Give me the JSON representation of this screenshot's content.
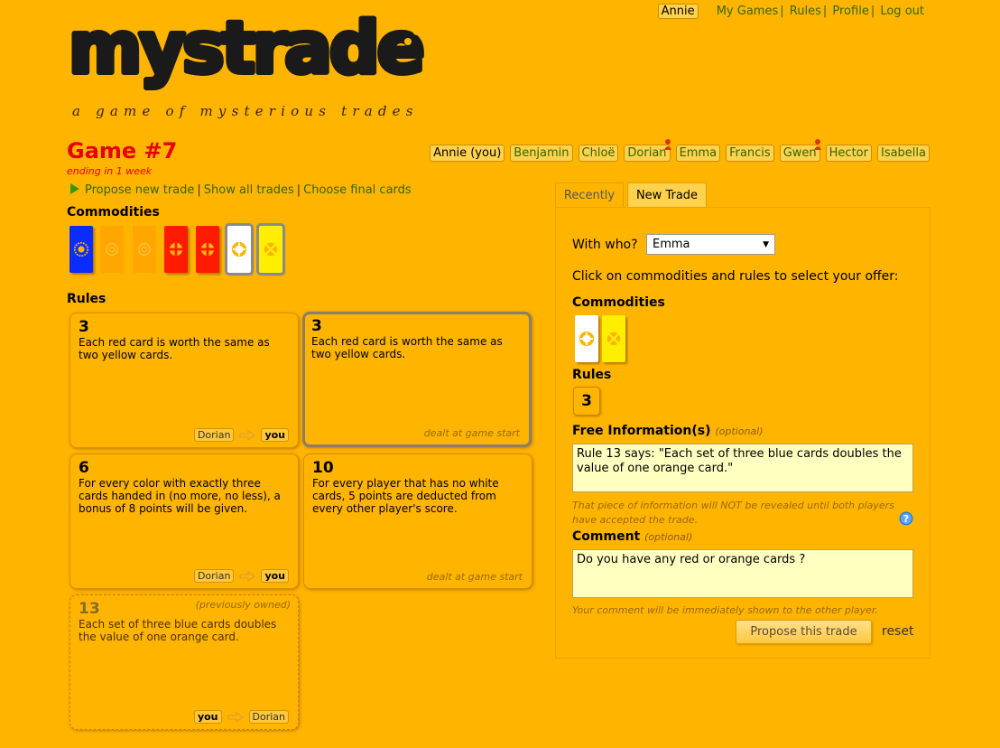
{
  "header": {
    "user": "Annie",
    "nav": [
      "My Games",
      "Rules",
      "Profile",
      "Log out"
    ],
    "tagline": "a game of mysterious trades"
  },
  "logo": {
    "text": "mystrade"
  },
  "game": {
    "title": "Game #7",
    "ending": "ending in 1 week"
  },
  "players": [
    "Annie (you)",
    "Benjamin",
    "Chloë",
    "Dorian",
    "Emma",
    "Francis",
    "Gwen",
    "Hector",
    "Isabella"
  ],
  "actions": {
    "propose": "Propose new trade",
    "show_all": "Show all trades",
    "choose_final": "Choose final cards"
  },
  "commodities_heading": "Commodities",
  "rules_heading": "Rules",
  "commodities": [
    {
      "color": "#0a2cff",
      "symbol": "sun-icon",
      "faded": false,
      "selected": false
    },
    {
      "color": "#ffa200",
      "symbol": "ring-icon",
      "faded": true,
      "selected": false
    },
    {
      "color": "#ffa200",
      "symbol": "ring-icon",
      "faded": true,
      "selected": false
    },
    {
      "color": "#ff1a00",
      "symbol": "cross-circle-icon",
      "faded": false,
      "selected": false
    },
    {
      "color": "#ff1a00",
      "symbol": "cross-circle-icon",
      "faded": false,
      "selected": false
    },
    {
      "color": "#ffffff",
      "symbol": "lifebuoy-icon",
      "faded": false,
      "selected": true
    },
    {
      "color": "#ffee00",
      "symbol": "wheel-icon",
      "faded": false,
      "selected": true
    }
  ],
  "rules": [
    {
      "num": "3",
      "text": "Each red card is worth the same as two yellow cards.",
      "from": "Dorian",
      "to": "you",
      "dealt": "",
      "note": ""
    },
    {
      "num": "3",
      "text": "Each red card is worth the same as two yellow cards.",
      "from": "",
      "to": "",
      "dealt": "dealt at game start",
      "note": ""
    },
    {
      "num": "6",
      "text": "For every color with exactly three cards handed in (no more, no less), a bonus of 8 points will be given.",
      "from": "Dorian",
      "to": "you",
      "dealt": "",
      "note": ""
    },
    {
      "num": "10",
      "text": "For every player that has no white cards, 5 points are deducted from every other player's score.",
      "from": "",
      "to": "",
      "dealt": "dealt at game start",
      "note": ""
    },
    {
      "num": "13",
      "text": "Each set of three blue cards doubles the value of one orange card.",
      "from": "you",
      "to": "Dorian",
      "dealt": "",
      "note": "(previously owned)"
    }
  ],
  "panel": {
    "tab_recent": "Recently",
    "tab_new": "New Trade",
    "with_label": "With who?",
    "with_value": "Emma",
    "instructions": "Click on commodities and rules to select your offer:",
    "commodities_heading": "Commodities",
    "rules_heading": "Rules",
    "selected_rule": "3",
    "free_label": "Free Information(s)",
    "optional": "(optional)",
    "free_value": "Rule 13 says: \"Each set of three blue cards doubles the value of one orange card.\"",
    "free_note": "That piece of information will NOT be revealed until both players have accepted the trade.",
    "comment_label": "Comment",
    "comment_value": "Do you have any red or orange cards ?",
    "comment_note": "Your comment will be immediately shown to the other player.",
    "propose_button": "Propose this trade",
    "reset": "reset"
  }
}
